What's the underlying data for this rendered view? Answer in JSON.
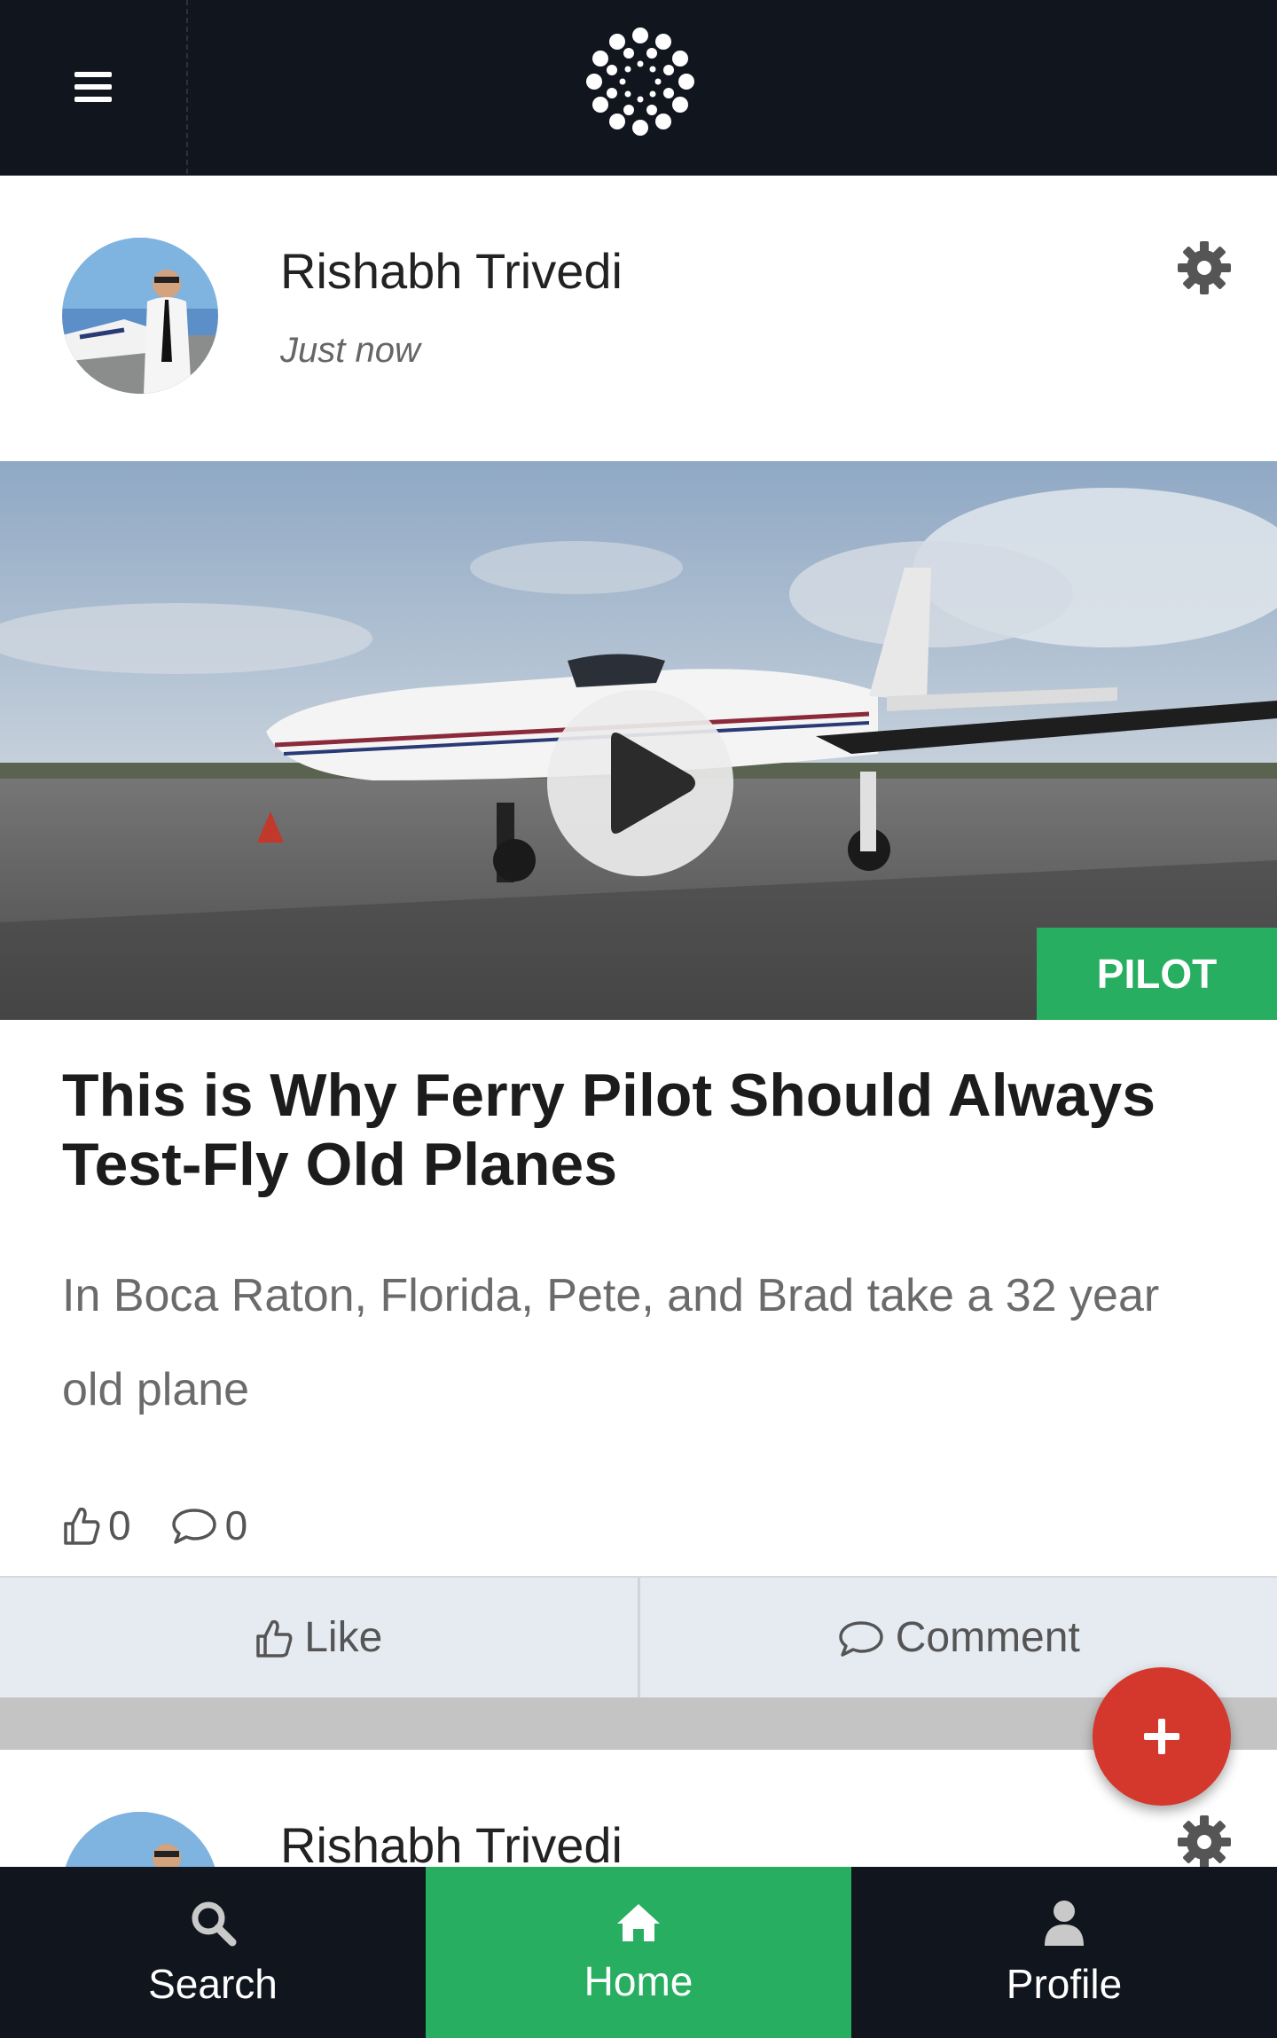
{
  "header": {
    "menu_icon": "hamburger-icon",
    "logo": "dotted-circle-logo"
  },
  "post": {
    "author": "Rishabh Trivedi",
    "time": "Just now",
    "category_tag": "PILOT",
    "title": "This is Why Ferry Pilot Should Always Test-Fly Old Planes",
    "excerpt": "In Boca Raton, Florida, Pete, and Brad take a 32 year old plane",
    "likes_count": "0",
    "comments_count": "0",
    "like_label": "Like",
    "comment_label": "Comment"
  },
  "post2": {
    "author": "Rishabh Trivedi"
  },
  "fab": {
    "icon": "plus-icon"
  },
  "nav": {
    "search": "Search",
    "home": "Home",
    "profile": "Profile"
  },
  "colors": {
    "topbar": "#11151e",
    "accent_green": "#27ae60",
    "fab_red": "#d4372c",
    "action_bar": "#e6ebf2"
  }
}
